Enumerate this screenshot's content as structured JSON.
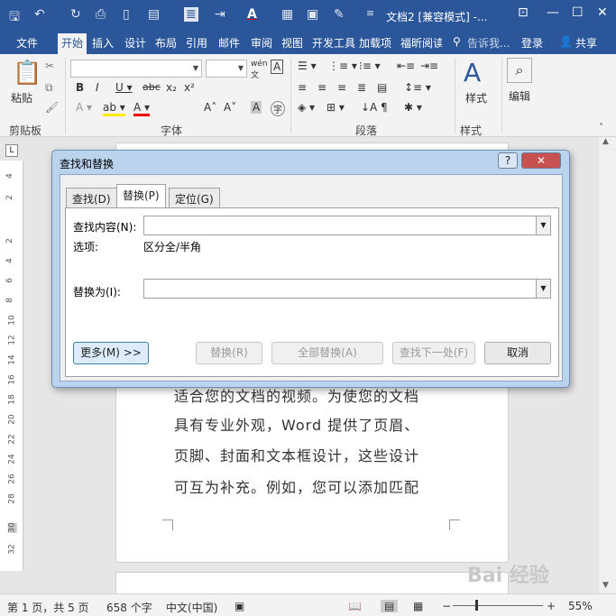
{
  "titlebar": {
    "doc_title": "文档2 [兼容模式] -...",
    "window_buttons": [
      "restore-ribbon-icon",
      "minimize-icon",
      "maximize-icon",
      "close-icon"
    ]
  },
  "ribbon_tabs": {
    "file": "文件",
    "items": [
      "开始",
      "插入",
      "设计",
      "布局",
      "引用",
      "邮件",
      "审阅",
      "视图",
      "开发工具",
      "加载项",
      "福昕阅读"
    ],
    "tell_me": "告诉我...",
    "login": "登录",
    "share": "共享"
  },
  "ribbon": {
    "paste_label": "粘贴",
    "groups": [
      "剪贴板",
      "字体",
      "段落",
      "样式",
      "编辑"
    ],
    "style_label": "样式",
    "edit_label": "编辑",
    "font_name": "",
    "font_size": ""
  },
  "document": {
    "lines": [
      "适合您的文档的视频。为使您的文档",
      "具有专业外观，Word 提供了页眉、",
      "页脚、封面和文本框设计，这些设计",
      "可互为补充。例如，您可以添加匹配"
    ],
    "ruler_left_numbers": [
      "4",
      "2",
      "2",
      "4",
      "6",
      "8",
      "10",
      "12",
      "14",
      "16",
      "18",
      "20",
      "22",
      "24",
      "26",
      "28",
      "30",
      "32"
    ]
  },
  "dialog": {
    "title": "查找和替换",
    "help": "?",
    "close": "✕",
    "tabs": [
      "查找(D)",
      "替换(P)",
      "定位(G)"
    ],
    "active_tab": 1,
    "find_label": "查找内容(N):",
    "find_value": "",
    "options_label": "选项:",
    "options_value": "区分全/半角",
    "replace_label": "替换为(I):",
    "replace_value": "",
    "buttons": {
      "more": "更多(M) >>",
      "replace": "替换(R)",
      "replace_all": "全部替换(A)",
      "find_next": "查找下一处(F)",
      "cancel": "取消"
    }
  },
  "status": {
    "page": "第 1 页，共 5 页",
    "words": "658 个字",
    "language": "中文(中国)",
    "zoom": "55%"
  },
  "watermark": "Bai 经验"
}
